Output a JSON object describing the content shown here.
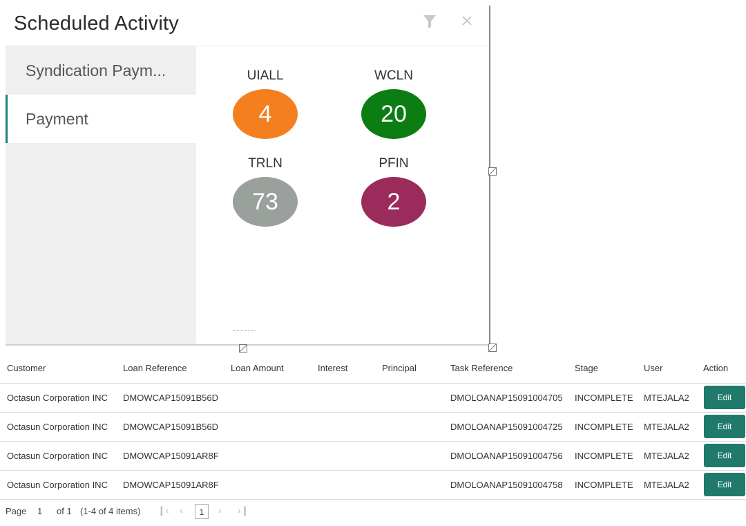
{
  "widget": {
    "title": "Scheduled Activity",
    "nav": [
      {
        "label": "Syndication Paym..."
      },
      {
        "label": "Payment"
      }
    ],
    "tiles": [
      {
        "label": "UIALL",
        "count": "4",
        "color": "#f47f1f"
      },
      {
        "label": "WCLN",
        "count": "20",
        "color": "#0c7d13"
      },
      {
        "label": "TRLN",
        "count": "73",
        "color": "#9aa19c"
      },
      {
        "label": "PFIN",
        "count": "2",
        "color": "#9b2b5b"
      }
    ]
  },
  "table": {
    "headers": [
      "Customer",
      "Loan Reference",
      "Loan Amount",
      "Interest",
      "Principal",
      "Task Reference",
      "Stage",
      "User",
      "Action"
    ],
    "rows": [
      {
        "customer": "Octasun Corporation INC",
        "loan_ref": "DMOWCAP15091B56D",
        "loan_amount": "",
        "interest": "",
        "principal": "",
        "task_ref": "DMOLOANAP15091004705",
        "stage": "INCOMPLETE",
        "user": "MTEJALA2",
        "action": "Edit"
      },
      {
        "customer": "Octasun Corporation INC",
        "loan_ref": "DMOWCAP15091B56D",
        "loan_amount": "",
        "interest": "",
        "principal": "",
        "task_ref": "DMOLOANAP15091004725",
        "stage": "INCOMPLETE",
        "user": "MTEJALA2",
        "action": "Edit"
      },
      {
        "customer": "Octasun Corporation INC",
        "loan_ref": "DMOWCAP15091AR8F",
        "loan_amount": "",
        "interest": "",
        "principal": "",
        "task_ref": "DMOLOANAP15091004756",
        "stage": "INCOMPLETE",
        "user": "MTEJALA2",
        "action": "Edit"
      },
      {
        "customer": "Octasun Corporation INC",
        "loan_ref": "DMOWCAP15091AR8F",
        "loan_amount": "",
        "interest": "",
        "principal": "",
        "task_ref": "DMOLOANAP15091004758",
        "stage": "INCOMPLETE",
        "user": "MTEJALA2",
        "action": "Edit"
      }
    ]
  },
  "pager": {
    "page_label": "Page",
    "page_value": "1",
    "of_label": "of 1",
    "items_label": "(1-4 of 4 items)",
    "current_page": "1"
  },
  "colors": {
    "accent": "#1a7d84",
    "edit_button": "#1f7a6b"
  }
}
